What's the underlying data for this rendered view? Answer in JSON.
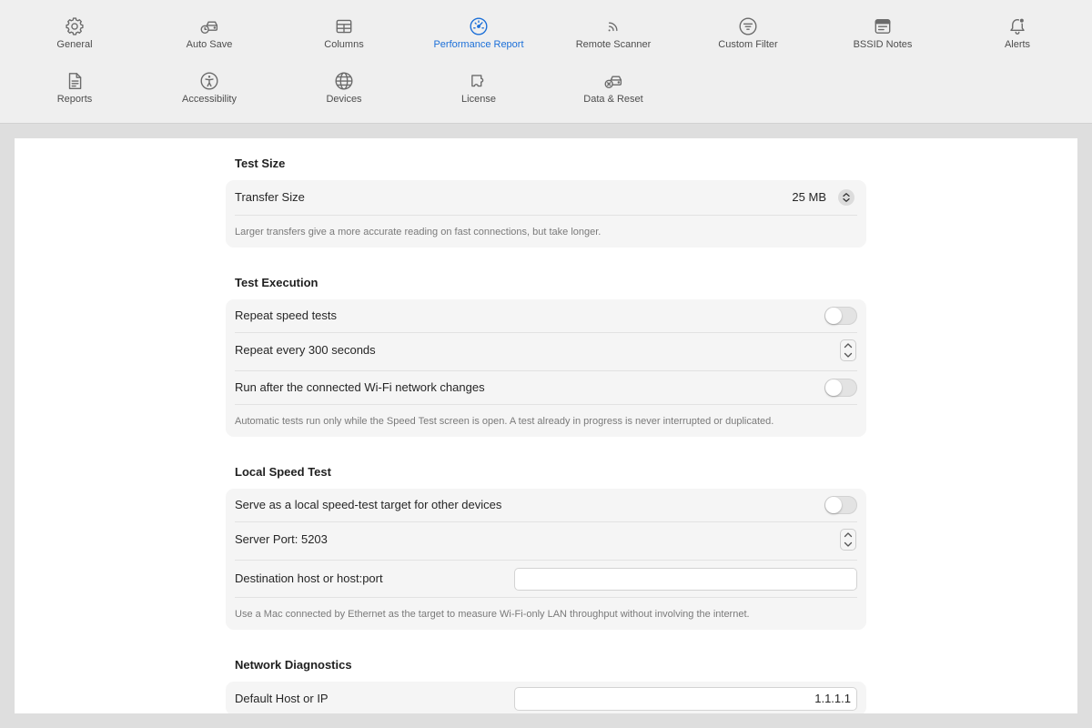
{
  "toolbar": {
    "accent_color": "#1b6fd8",
    "selected_tab": "Performance Report",
    "tabs": [
      {
        "label": "General",
        "icon": "gear-icon"
      },
      {
        "label": "Auto Save",
        "icon": "drive-clock-icon"
      },
      {
        "label": "Columns",
        "icon": "table-columns-icon"
      },
      {
        "label": "Performance Report",
        "icon": "speedometer-icon"
      },
      {
        "label": "Remote Scanner",
        "icon": "signal-waves-icon"
      },
      {
        "label": "Custom Filter",
        "icon": "filter-circle-icon"
      },
      {
        "label": "BSSID Notes",
        "icon": "note-window-icon"
      },
      {
        "label": "Alerts",
        "icon": "bell-badge-icon"
      },
      {
        "label": "Reports",
        "icon": "document-icon"
      },
      {
        "label": "Accessibility",
        "icon": "accessibility-icon"
      },
      {
        "label": "Devices",
        "icon": "globe-icon"
      },
      {
        "label": "License",
        "icon": "license-puzzle-icon"
      },
      {
        "label": "Data & Reset",
        "icon": "drive-reset-icon"
      }
    ]
  },
  "test_size": {
    "title": "Test Size",
    "transfer_size": {
      "label": "Transfer Size",
      "value": "25 MB"
    },
    "note": "Larger transfers give a more accurate reading on fast connections, but take longer."
  },
  "test_execution": {
    "title": "Test Execution",
    "repeat_speed_tests": {
      "label": "Repeat speed tests",
      "on": false
    },
    "repeat_interval": {
      "label": "Repeat every 300 seconds"
    },
    "run_on_network_change": {
      "label": "Run after the connected Wi-Fi network changes",
      "on": false
    },
    "note": "Automatic tests run only while the Speed Test screen is open. A test already in progress is never interrupted or duplicated."
  },
  "local_speed_test": {
    "title": "Local Speed Test",
    "serve_as_target": {
      "label": "Serve as a local speed-test target for other devices",
      "on": false
    },
    "server_port": {
      "label": "Server Port: 5203"
    },
    "destination": {
      "label": "Destination host or host:port",
      "value": ""
    },
    "note": "Use a Mac connected by Ethernet as the target to measure Wi-Fi-only LAN throughput without involving the internet."
  },
  "network_diagnostics": {
    "title": "Network Diagnostics",
    "default_host": {
      "label": "Default Host or IP",
      "value": "1.1.1.1"
    }
  }
}
